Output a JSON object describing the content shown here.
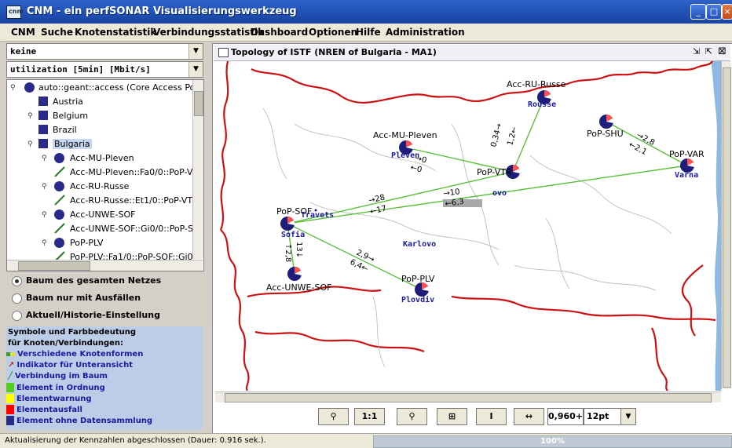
{
  "window": {
    "title": "CNM - ein perfSONAR Visualisierungswerkzeug",
    "app_icon_text": "cnm"
  },
  "menu": [
    "CNM",
    "Suche",
    "Knotenstatistik",
    "Verbindungsstatistik",
    "Dashboard",
    "Optionen",
    "Hilfe",
    "Administration"
  ],
  "left": {
    "combo1": "keine",
    "combo2": "utilization [5min] [Mbit/s]",
    "tree": [
      {
        "label": "auto::geant::access (Core Access Poir",
        "icon": "circle"
      },
      {
        "label": "Austria",
        "icon": "square"
      },
      {
        "label": "Belgium",
        "icon": "square"
      },
      {
        "label": "Brazil",
        "icon": "square"
      },
      {
        "label": "Bulgaria",
        "icon": "square"
      },
      {
        "label": "Acc-MU-Pleven",
        "icon": "circle"
      },
      {
        "label": "Acc-MU-Pleven::Fa0/0::PoP-V",
        "icon": "line"
      },
      {
        "label": "Acc-RU-Russe",
        "icon": "circle"
      },
      {
        "label": "Acc-RU-Russe::Et1/0::PoP-VT",
        "icon": "line"
      },
      {
        "label": "Acc-UNWE-SOF",
        "icon": "circle"
      },
      {
        "label": "Acc-UNWE-SOF::Gi0/0::PoP-S",
        "icon": "line"
      },
      {
        "label": "PoP-PLV",
        "icon": "circle"
      },
      {
        "label": "PoP-PLV::Fa1/0::PoP-SOF::Gi0",
        "icon": "line"
      }
    ],
    "radios": [
      {
        "label": "Baum des gesamten Netzes",
        "checked": true
      },
      {
        "label": "Baum nur mit Ausfällen",
        "checked": false
      },
      {
        "label": "Aktuell/Historie-Einstellung",
        "checked": false
      }
    ],
    "legend": {
      "title1": "Symbole und Farbbedeutung",
      "title2": "für Knoten/Verbindungen:",
      "items": [
        {
          "label": "Verschiedene Knotenformen",
          "color": "#1a1aa0"
        },
        {
          "label": "Indikator für Unteransicht",
          "color": "#1a1aa0"
        },
        {
          "label": "Verbindung im Baum",
          "color": "#1a1aa0"
        },
        {
          "label": "Element in Ordnung",
          "color": "#1a1aa0"
        },
        {
          "label": "Elementwarnung",
          "color": "#1a1aa0"
        },
        {
          "label": "Elementausfall",
          "color": "#1a1aa0"
        },
        {
          "label": "Element ohne Datensammlung",
          "color": "#1a1aa0"
        }
      ],
      "swatches": [
        "#2e9e2e",
        "#cc2222",
        "#1a7f1a",
        "#55cc22",
        "#ffff00",
        "#ff0000",
        "#2a2a8a"
      ]
    }
  },
  "map": {
    "title": "Topology of ISTF (NREN of Bulgaria - MA1)",
    "nodes": [
      {
        "label": "Acc-RU-Russe",
        "city": "Rousse"
      },
      {
        "label": "Acc-MU-Pleven",
        "city": "Pleven"
      },
      {
        "label": "PoP-SHU",
        "city": ""
      },
      {
        "label": "PoP-VAR",
        "city": "Varna"
      },
      {
        "label": "PoP-VTR",
        "city": "ovo"
      },
      {
        "label": "PoP-SOF",
        "city": "Sofia"
      },
      {
        "label": "Acc-UNWE-SOF",
        "city": ""
      },
      {
        "label": "PoP-PLV",
        "city": "Plovdiv"
      }
    ],
    "cities": {
      "travets": "Travets",
      "karlovo": "Karlovo"
    },
    "links": {
      "russe_a": "0,34→",
      "russe_b": "1,2←",
      "pleven_a": "→0",
      "pleven_b": "←0",
      "shu_a": "→2,8",
      "shu_b": "←2,1",
      "vtr_a": "→10",
      "vtr_b": "←6,3",
      "sof_a": "→28",
      "sof_b": "←17",
      "unwe_a": "↑2,8",
      "unwe_b": "13↓",
      "plv_a": "2,9→",
      "plv_b": "6,4←"
    },
    "toolbar": {
      "zoom_ratio": "1:1",
      "zoom_value": "0,960+",
      "font_size": "12pt"
    }
  },
  "status": {
    "text": "Aktualisierung der Kennzahlen abgeschlossen (Dauer: 0.916 sek.).",
    "progress": "100%",
    "progress_fraction": 1.0
  }
}
